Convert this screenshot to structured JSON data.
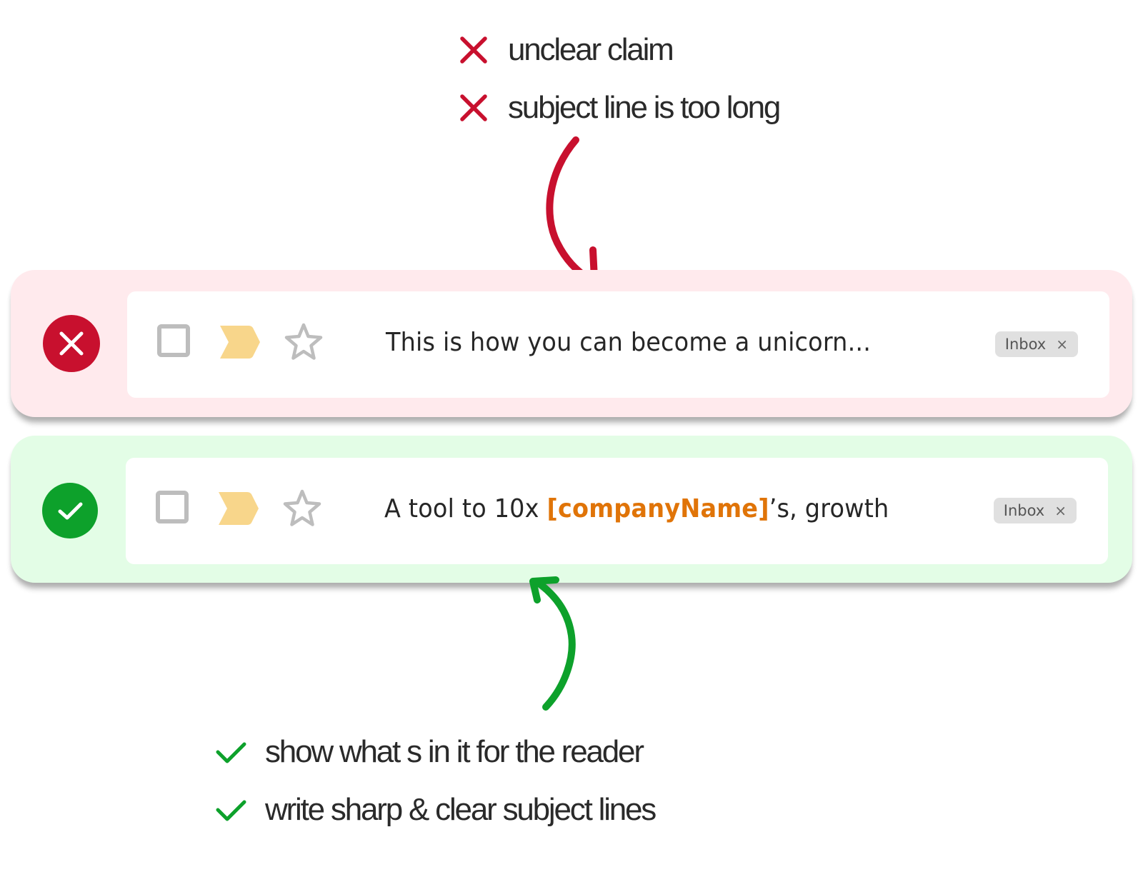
{
  "colors": {
    "bad_accent": "#c8102e",
    "bad_background": "#ffeaed",
    "good_accent": "#0da12b",
    "good_background": "#e3fde6",
    "label_tag": "#f8d68b",
    "icon_gray": "#bdbdbd",
    "variable_highlight": "#e07408"
  },
  "top_notes": [
    {
      "icon": "x-mark-icon",
      "text": "unclear claim"
    },
    {
      "icon": "x-mark-icon",
      "text": "subject line is too long"
    }
  ],
  "bad_example": {
    "status_icon": "x-circle-icon",
    "row": {
      "checkbox_icon": "checkbox-icon",
      "label_icon": "label-tag-icon",
      "star_icon": "star-icon",
      "subject": "This is how you can become a unicorn...",
      "chip_label": "Inbox",
      "chip_close": "×"
    }
  },
  "good_example": {
    "status_icon": "check-circle-icon",
    "row": {
      "checkbox_icon": "checkbox-icon",
      "label_icon": "label-tag-icon",
      "star_icon": "star-icon",
      "subject_prefix": "A tool to 10x ",
      "subject_variable": "[companyName]",
      "subject_suffix": "’s, growth",
      "chip_label": "Inbox",
      "chip_close": "×"
    }
  },
  "bottom_notes": [
    {
      "icon": "check-mark-icon",
      "text": "show what s in it for the reader"
    },
    {
      "icon": "check-mark-icon",
      "text": "write sharp & clear subject lines"
    }
  ]
}
